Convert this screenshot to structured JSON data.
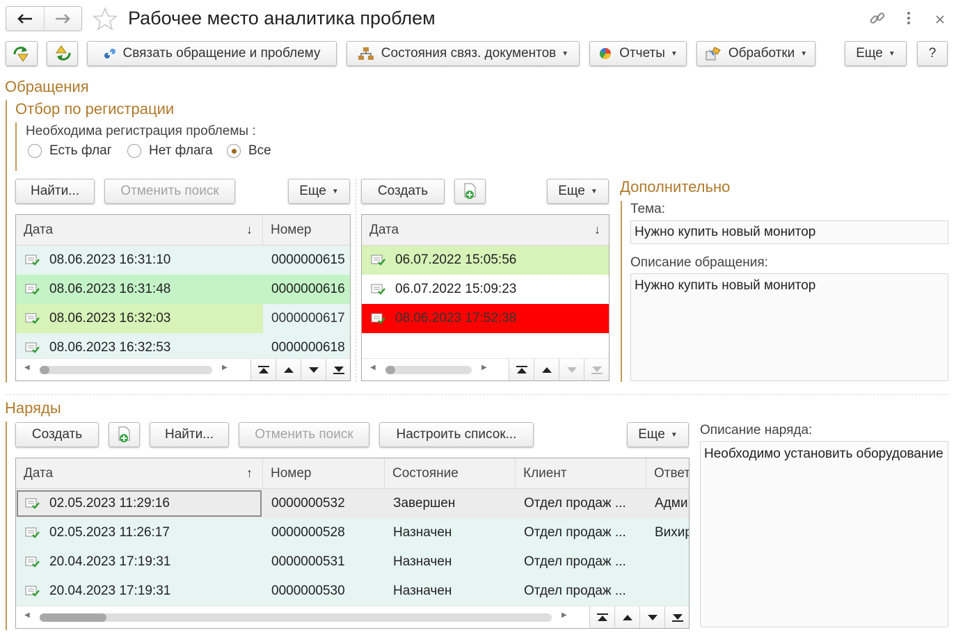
{
  "window": {
    "title": "Рабочее место аналитика проблем"
  },
  "toolbar": {
    "link_label": "Связать обращение и проблему",
    "states_label": "Состояния связ. документов",
    "reports_label": "Отчеты",
    "processing_label": "Обработки",
    "more_label": "Еще",
    "help_label": "?"
  },
  "appeals": {
    "title": "Обращения",
    "filter": {
      "title": "Отбор по регистрации",
      "question": "Необходима  регистрация проблемы :",
      "options": [
        "Есть флаг",
        "Нет флага",
        "Все"
      ],
      "selected": "Все"
    },
    "left_toolbar": {
      "find_label": "Найти...",
      "cancel_label": "Отменить поиск",
      "more_label": "Еще"
    },
    "left_table": {
      "columns": [
        "Дата",
        "Номер"
      ],
      "sort": "↓",
      "rows": [
        {
          "date": "08.06.2023 16:31:10",
          "number": "0000000615"
        },
        {
          "date": "08.06.2023 16:31:48",
          "number": "0000000616"
        },
        {
          "date": "08.06.2023 16:32:03",
          "number": "0000000617"
        },
        {
          "date": "08.06.2023 16:32:53",
          "number": "0000000618"
        }
      ]
    },
    "mid_toolbar": {
      "create_label": "Создать",
      "more_label": "Еще"
    },
    "mid_table": {
      "columns": [
        "Дата"
      ],
      "sort": "↓",
      "rows": [
        {
          "date": "06.07.2022 15:05:56"
        },
        {
          "date": "06.07.2022 15:09:23"
        },
        {
          "date": "08.06.2023 17:52:38"
        }
      ]
    },
    "additional": {
      "title": "Дополнительно",
      "topic_label": "Тема:",
      "topic_value": "Нужно купить новый монитор",
      "description_label": "Описание обращения:",
      "description_value": "Нужно купить новый монитор"
    }
  },
  "orders": {
    "title": "Наряды",
    "toolbar": {
      "create_label": "Создать",
      "find_label": "Найти...",
      "cancel_label": "Отменить поиск",
      "configure_label": "Настроить список...",
      "more_label": "Еще"
    },
    "table": {
      "columns": [
        "Дата",
        "Номер",
        "Состояние",
        "Клиент",
        "Ответ"
      ],
      "sort": "↑",
      "rows": [
        {
          "date": "02.05.2023 11:29:16",
          "number": "0000000532",
          "state": "Завершен",
          "client": "Отдел продаж ...",
          "resp": "Адми"
        },
        {
          "date": "02.05.2023 11:26:17",
          "number": "0000000528",
          "state": "Назначен",
          "client": "Отдел продаж ...",
          "resp": "Вихир"
        },
        {
          "date": "20.04.2023 17:19:31",
          "number": "0000000531",
          "state": "Назначен",
          "client": "Отдел продаж ...",
          "resp": ""
        },
        {
          "date": "20.04.2023 17:19:31",
          "number": "0000000530",
          "state": "Назначен",
          "client": "Отдел продаж ...",
          "resp": ""
        }
      ]
    },
    "description_label": "Описание наряда:",
    "description_value": "Необходимо установить оборудование"
  },
  "colors": {
    "accent": "#b07a2b",
    "row_mint": "#e6f5f1",
    "row_green": "#c5f3c8",
    "row_lime": "#d7f3b8",
    "row_red": "#ff0000",
    "row_selected": "#ececec"
  },
  "icons": [
    "back-arrow-icon",
    "forward-arrow-icon",
    "star-icon",
    "link-icon",
    "kebab-menu-icon",
    "close-icon",
    "refresh-up-icon",
    "refresh-down-icon",
    "link-appeal-icon",
    "hierarchy-icon",
    "pie-chart-icon",
    "processing-icon",
    "add-document-icon",
    "document-check-icon"
  ]
}
